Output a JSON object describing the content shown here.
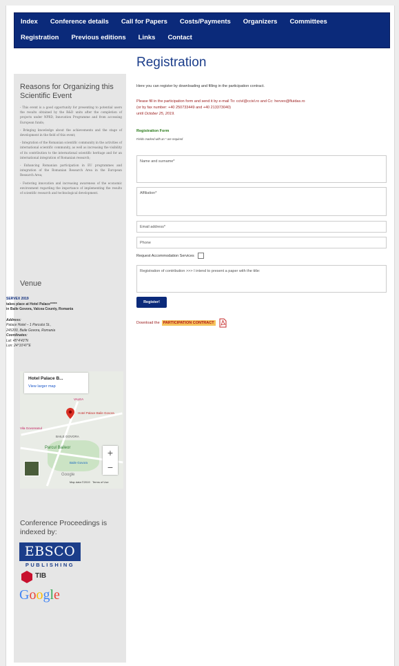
{
  "nav": {
    "row1": [
      "Index",
      "Conference details",
      "Call for Papers",
      "Costs/Payments",
      "Organizers",
      "Committees"
    ],
    "row2": [
      "Registration",
      "Previous editions",
      "Links",
      "Contact"
    ]
  },
  "sidebar": {
    "reasons_title": "Reasons for Organizing this Scientific Event",
    "reasons": [
      "- This event is a good opportunity for presenting to potential users the results obtained by the R&D units after the completion of projects under NPRD, Innovation Programme and from accessing European funds;",
      "- Bringing knowledge about the achievements and the stage of development in the field of this event;",
      "- Integration of the Romanian scientific community in the activities of international scientific community, as well as increasing the visibility of its contribution to the international scientific heritage and for an international integration of Romanian research;",
      "- Enhancing Romanian participation in EU programmes and integration of the Romanian Research Area in the European Research Area;",
      "- Fostering innovation and increasing awareness of the economic environment regarding the importance of implementing the results of scientific research and technological development."
    ],
    "venue_title": "Venue",
    "venue_event": "SERVEX 2019",
    "venue_line1": "takes place at Hotel Palace*****",
    "venue_line2": "in Baile Govora, Valcea County, Romania",
    "address_label": "Address:",
    "address_line1": "Palace Hotel – 1 Parcului St.,",
    "address_line2": "245200, Baile Govora, Romania",
    "coordinates_label": "Coordinates:",
    "lat": "Lat: 45°4'43\"N",
    "lon": "Lon: 24°10'47\"E",
    "map": {
      "place": "Hotel Palace B...",
      "larger_map": "View larger map",
      "label_valea": "VALEA",
      "label_hotel": "Hotel Palace Baile Govora",
      "label_vila": "Vila Govoreanul",
      "label_baile": "BAILE GOVORA",
      "label_parcul": "Parcul Baileor",
      "label_govora": "Baile Govora",
      "map_data": "Map data ©2019",
      "terms": "Terms of Use",
      "google": "Google"
    },
    "proceedings_title": "Conference Proceedings is indexed by:",
    "ebsco": "EBSCO",
    "publishing": "PUBLISHING",
    "tib": "TIB",
    "google_logo": [
      "G",
      "o",
      "o",
      "g",
      "l",
      "e"
    ]
  },
  "main": {
    "title": "Registration",
    "intro": "Here you can register by downloading and filling in the participation contract.",
    "instructions_line1": "Please fill in the participation form and send it by e-mail To: ccivl@ccivl.ro and Cc: hervex@fluidas.ro",
    "instructions_line2": "(or by fax number: +40 250733449 and +40 213373040)",
    "instructions_until": "until ",
    "deadline": "October 25, 2019.",
    "form_title": "Registration Form",
    "form_note": "Fields marked with an * are required",
    "fields": {
      "name": "Name and surname*",
      "affiliation": "Affiliation*",
      "email": "Email address*",
      "phone": "Phone",
      "contribution": "Registration of contribution >>> I intend to present a paper with the title:"
    },
    "accommodation": "Request Accommodation Services",
    "register_button": "Register!",
    "download_text": "Download the",
    "download_link": "PARTICIPATION CONTRACT"
  }
}
